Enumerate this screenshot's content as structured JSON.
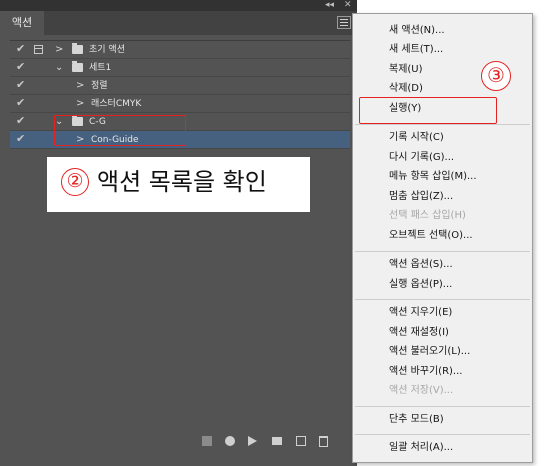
{
  "panel": {
    "tab_label": "액션",
    "title_controls": [
      "◂◂",
      "✕"
    ]
  },
  "actions": [
    {
      "label": "초기 액션"
    },
    {
      "label": "세트1"
    },
    {
      "label": "정렬"
    },
    {
      "label": "래스터CMYK"
    },
    {
      "label": "C-G"
    },
    {
      "label": "Con-Guide"
    }
  ],
  "callout": {
    "number": "②",
    "text": "액션 목록을 확인"
  },
  "flyout": {
    "items": [
      "새 액션(N)...",
      "새 세트(T)...",
      "복제(U)",
      "삭제(D)",
      "실행(Y)",
      "기록 시작(C)",
      "다시 기록(G)...",
      "메뉴 항목 삽입(M)...",
      "멈춤 삽입(Z)...",
      "선택 패스 삽입(H)",
      "오브젝트 선택(O)...",
      "액션 옵션(S)...",
      "실행 옵션(P)...",
      "액션 지우기(E)",
      "액션 재설정(I)",
      "액션 불러오기(L)...",
      "액션 바꾸기(R)...",
      "액션 저장(V)...",
      "단추 모드(B)",
      "일괄 처리(A)..."
    ],
    "callout_number": "③"
  },
  "colors": {
    "accent_red": "#e52222",
    "selected_row": "#46607f",
    "panel_bg": "#535353"
  }
}
